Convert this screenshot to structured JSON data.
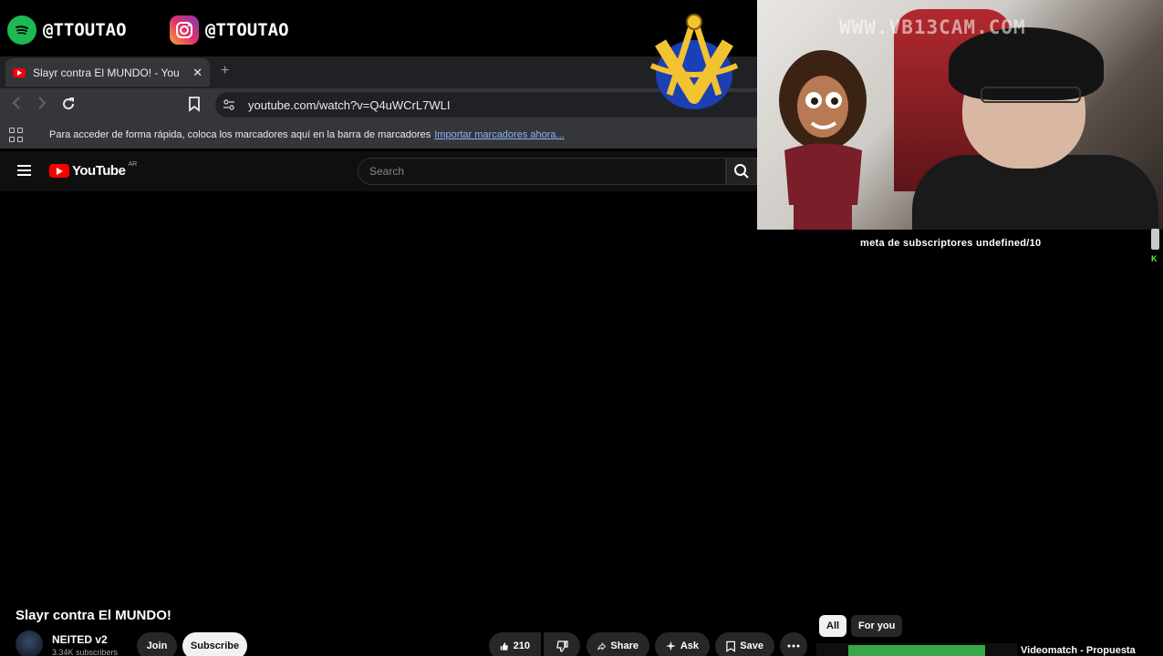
{
  "overlay": {
    "spotify_handle": "@TTOUTAO",
    "instagram_handle": "@TTOUTAO",
    "cam_watermark": "WWW.VB13CAM.COM",
    "goal_text": "meta de subscriptores undefined/10",
    "badge": "K"
  },
  "browser": {
    "tab_title": "Slayr contra El MUNDO! - YouTube",
    "tab_close": "✕",
    "new_tab": "+",
    "url": "youtube.com/watch?v=Q4uWCrL7WLI",
    "bookmarks_bar_text": "Para acceder de forma rápida, coloca los marcadores aquí en la barra de marcadores",
    "bookmarks_link": "Importar marcadores ahora..."
  },
  "youtube": {
    "logo_text": "YouTube",
    "country_code": "AR",
    "search_placeholder": "Search",
    "video_title": "Slayr contra El MUNDO!",
    "channel_name": "NEITED v2",
    "subscribers": "3.34K subscribers",
    "join_label": "Join",
    "subscribe_label": "Subscribe",
    "like_count": "210",
    "share_label": "Share",
    "ask_label": "Ask",
    "save_label": "Save",
    "chips": [
      "All",
      "For you"
    ],
    "recommendation_title": "Videomatch - Propuesta"
  },
  "colors": {
    "youtube_red": "#ff0000",
    "spotify_green": "#1DB954",
    "kick_green": "#53fc18",
    "link_blue": "#8ab4f8"
  }
}
